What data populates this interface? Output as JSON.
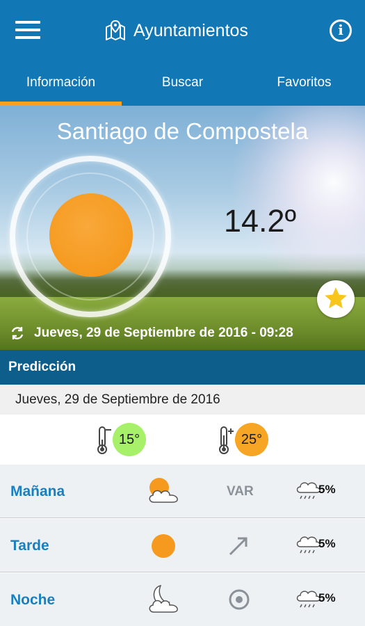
{
  "app_bar": {
    "title": "Ayuntamientos",
    "menu_icon": "hamburger-menu-icon",
    "map_icon": "map-pin-icon",
    "info_icon": "info-icon",
    "info_glyph": "i"
  },
  "tabs": [
    {
      "label": "Información",
      "active": true
    },
    {
      "label": "Buscar",
      "active": false
    },
    {
      "label": "Favoritos",
      "active": false
    }
  ],
  "current": {
    "city": "Santiago de Compostela",
    "temperature": "14.2º",
    "condition_icon": "sun-icon",
    "updated": "Jueves, 29 de Septiembre de 2016 - 09:28",
    "favorite_icon": "star-icon"
  },
  "prediction": {
    "header": "Predicción",
    "date": "Jueves, 29 de Septiembre de 2016",
    "min_temp": "15°",
    "max_temp": "25°",
    "periods": [
      {
        "label": "Mañana",
        "sky_icon": "sun-behind-cloud-icon",
        "wind_text": "VAR",
        "rain_icon": "rain-cloud-icon",
        "rain_prob": "5%"
      },
      {
        "label": "Tarde",
        "sky_icon": "sun-icon",
        "wind_icon": "arrow-northeast-icon",
        "rain_icon": "rain-cloud-icon",
        "rain_prob": "5%"
      },
      {
        "label": "Noche",
        "sky_icon": "moon-behind-cloud-icon",
        "wind_icon": "calm-circle-icon",
        "rain_icon": "rain-cloud-icon",
        "rain_prob": "5%"
      }
    ]
  },
  "colors": {
    "primary": "#1177b5",
    "dark_primary": "#0e5e8c",
    "accent": "#f6a21c",
    "period_label": "#1a7fbf",
    "min_badge": "#a7f06a",
    "max_badge": "#f7a524"
  }
}
